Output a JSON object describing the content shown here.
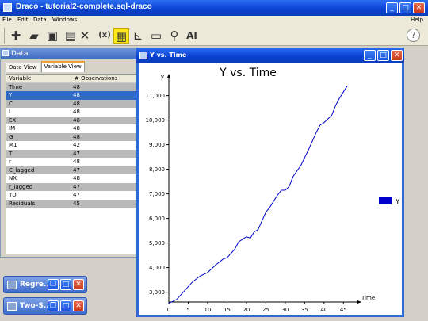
{
  "app": {
    "title": "Draco - tutorial2-complete.sql-draco"
  },
  "menu": {
    "items": [
      "File",
      "Edit",
      "Data",
      "Windows"
    ],
    "help": "Help"
  },
  "toolbar": {
    "buttons": [
      "add-icon",
      "open-folder-icon",
      "save-icon",
      "save-as-icon",
      "delete-icon",
      "variable-icon",
      "data-view-icon",
      "chart-icon",
      "print-icon",
      "settings-icon",
      "ai-icon"
    ],
    "variable_label": "(x)",
    "ai_label": "AI",
    "help_label": "?"
  },
  "data_panel": {
    "title": "Data",
    "tabs": [
      "Data View",
      "Variable View"
    ],
    "selected_tab": "Variable View",
    "columns": [
      "Variable",
      "# Observations"
    ],
    "rows": [
      [
        "Time",
        "48"
      ],
      [
        "Y",
        "48"
      ],
      [
        "C",
        "48"
      ],
      [
        "I",
        "48"
      ],
      [
        "EX",
        "48"
      ],
      [
        "IM",
        "48"
      ],
      [
        "G",
        "48"
      ],
      [
        "M1",
        "42"
      ],
      [
        "T",
        "47"
      ],
      [
        "r",
        "48"
      ],
      [
        "C_lagged",
        "47"
      ],
      [
        "NX",
        "48"
      ],
      [
        "r_lagged",
        "47"
      ],
      [
        "YD",
        "47"
      ],
      [
        "Residuals",
        "45"
      ]
    ]
  },
  "minimized": [
    {
      "label": "Regre..."
    },
    {
      "label": "Two-S..."
    }
  ],
  "chart_window": {
    "title": "Y vs. Time"
  },
  "colors": {
    "line": "#0000cc",
    "titlebar": "#0a3fd1"
  },
  "chart_data": {
    "type": "line",
    "title": "Y vs. Time",
    "xlabel": "Time",
    "ylabel": "y",
    "xlim": [
      0,
      48
    ],
    "ylim": [
      2600,
      11600
    ],
    "xticks": [
      0,
      5,
      10,
      15,
      20,
      25,
      30,
      35,
      40,
      45
    ],
    "yticks": [
      3000,
      4000,
      5000,
      6000,
      7000,
      8000,
      9000,
      10000,
      11000
    ],
    "ytick_labels": [
      "3,000",
      "4,000",
      "5,000",
      "6,000",
      "7,000",
      "8,000",
      "9,000",
      "10,000",
      "11,000"
    ],
    "legend": "right",
    "series": [
      {
        "name": "Y",
        "x": [
          0,
          2,
          4,
          6,
          8,
          10,
          12,
          14,
          15,
          17,
          18,
          19,
          20,
          21,
          22,
          23,
          24,
          25,
          26,
          27,
          28,
          29,
          30,
          31,
          32,
          34,
          36,
          38,
          39,
          40,
          42,
          43,
          44,
          46
        ],
        "y": [
          2550,
          2700,
          3050,
          3400,
          3650,
          3800,
          4100,
          4350,
          4400,
          4750,
          5050,
          5150,
          5250,
          5200,
          5450,
          5550,
          5900,
          6250,
          6450,
          6700,
          6950,
          7150,
          7150,
          7300,
          7700,
          8150,
          8800,
          9500,
          9800,
          9900,
          10200,
          10600,
          10900,
          11400
        ]
      }
    ]
  }
}
